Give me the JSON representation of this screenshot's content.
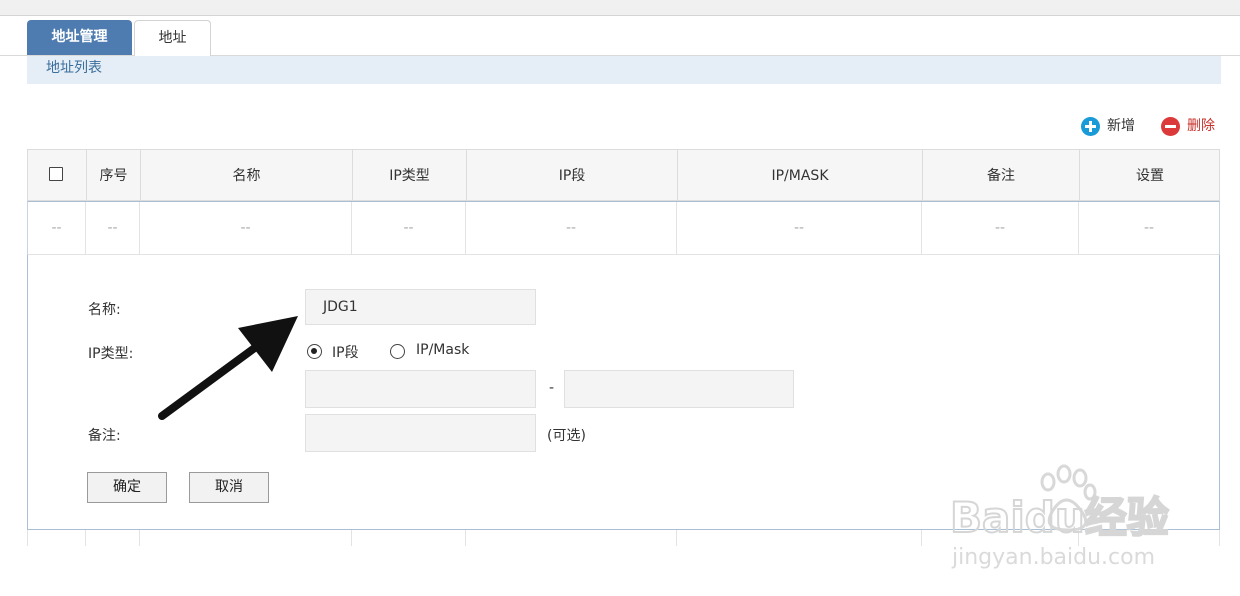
{
  "tabs": [
    {
      "label": "地址管理",
      "active": true
    },
    {
      "label": "地址",
      "active": false
    }
  ],
  "section_title": "地址列表",
  "toolbar": {
    "add_label": "新增",
    "delete_label": "删除"
  },
  "table": {
    "columns": [
      "序号",
      "名称",
      "IP类型",
      "IP段",
      "IP/MASK",
      "备注",
      "设置"
    ],
    "empty_row": [
      "--",
      "--",
      "--",
      "--",
      "--",
      "--",
      "--",
      "--"
    ]
  },
  "form": {
    "name_label": "名称:",
    "name_value": "JDG1",
    "ip_type_label": "IP类型:",
    "radio_ip_range": "IP段",
    "radio_ip_mask": "IP/Mask",
    "selected_ip_type": "IP段",
    "range_separator": "-",
    "range_start_value": "",
    "range_end_value": "",
    "note_label": "备注:",
    "note_value": "",
    "optional_hint": "(可选)",
    "confirm_label": "确定",
    "cancel_label": "取消"
  },
  "watermark": {
    "brand": "Baidu经验",
    "url": "jingyan.baidu.com"
  },
  "colors": {
    "tab_active": "#4e7bb0",
    "add_icon": "#1a9ad6",
    "delete_icon": "#dc3a3a",
    "subheader_bg": "#e5eef6"
  }
}
